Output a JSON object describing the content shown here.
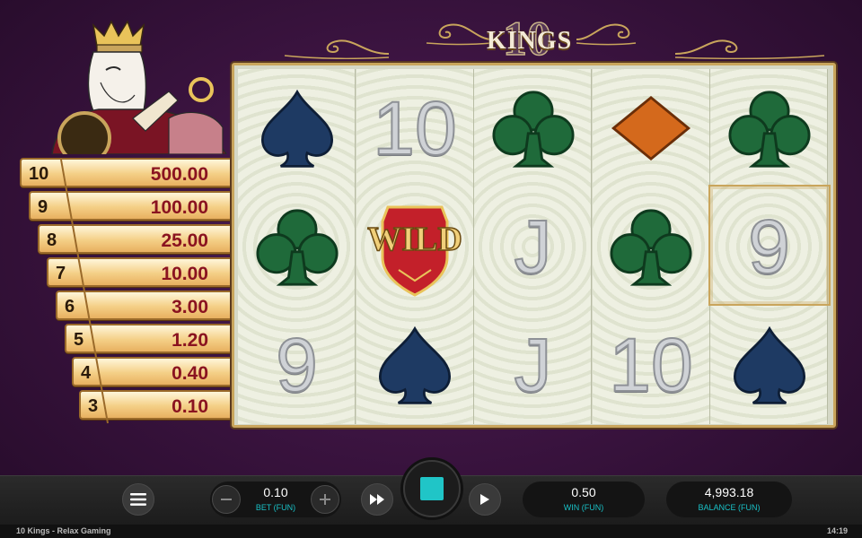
{
  "game": {
    "logo_number": "10",
    "logo_word": "KINGS"
  },
  "paytable": [
    {
      "count": "10",
      "amount": "500.00"
    },
    {
      "count": "9",
      "amount": "100.00"
    },
    {
      "count": "8",
      "amount": "25.00"
    },
    {
      "count": "7",
      "amount": "10.00"
    },
    {
      "count": "6",
      "amount": "3.00"
    },
    {
      "count": "5",
      "amount": "1.20"
    },
    {
      "count": "4",
      "amount": "0.40"
    },
    {
      "count": "3",
      "amount": "0.10"
    }
  ],
  "reels": [
    [
      "spade",
      "club",
      "9"
    ],
    [
      "10",
      "wild",
      "spade"
    ],
    [
      "club",
      "J",
      "J"
    ],
    [
      "diamond",
      "club",
      "10"
    ],
    [
      "club",
      "9",
      "spade"
    ]
  ],
  "highlighted_cell": {
    "reel": 5,
    "row": 2
  },
  "symbol_text": {
    "wild_label": "WILD",
    "nine": "9",
    "ten": "10",
    "jack": "J"
  },
  "controls": {
    "bet_value": "0.10",
    "bet_label": "BET (FUN)",
    "win_value": "0.50",
    "win_label": "WIN (FUN)",
    "balance_value": "4,993.18",
    "balance_label": "BALANCE (FUN)"
  },
  "footer": {
    "title": "10 Kings - Relax Gaming",
    "clock": "14:19"
  },
  "colors": {
    "background": "#3c1441",
    "spade": "#1e3a63",
    "club": "#1f6a3a",
    "diamond": "#d4691c",
    "wild_red": "#c3202a",
    "accent_teal": "#20c5c7",
    "paytable_amount": "#8a1320"
  }
}
